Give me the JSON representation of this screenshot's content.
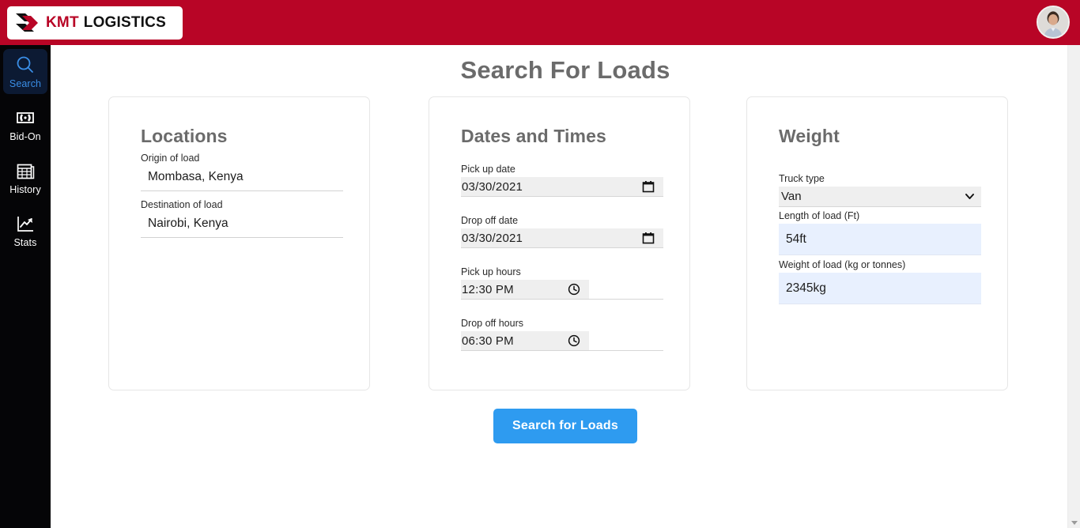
{
  "header": {
    "logo_icon": "double-chevron-arrow-icon",
    "logo_primary": "KMT",
    "logo_secondary": "LOGISTICS",
    "brand_red": "#b80526",
    "avatar_icon": "user-avatar-photo"
  },
  "sidebar": {
    "background": "#050507",
    "active_color": "#3a8ee6",
    "items": [
      {
        "label": "Search",
        "icon": "search-magnifier-icon",
        "active": true
      },
      {
        "label": "Bid-On",
        "icon": "banknote-money-icon",
        "active": false
      },
      {
        "label": "History",
        "icon": "newspaper-table-icon",
        "active": false
      },
      {
        "label": "Stats",
        "icon": "line-chart-up-icon",
        "active": false
      }
    ]
  },
  "main": {
    "page_title": "Search For Loads",
    "cards": {
      "locations": {
        "title": "Locations",
        "origin_label": "Origin of load",
        "origin_value": "Mombasa, Kenya",
        "destination_label": "Destination of load",
        "destination_value": "Nairobi, Kenya"
      },
      "dates": {
        "title": "Dates and Times",
        "pickup_date_label": "Pick up date",
        "pickup_date_value": "03/30/2021",
        "dropoff_date_label": "Drop off date",
        "dropoff_date_value": "03/30/2021",
        "pickup_hours_label": "Pick up hours",
        "pickup_hours_value": "12:30 PM",
        "dropoff_hours_label": "Drop off hours",
        "dropoff_hours_value": "06:30 PM",
        "date_icon": "calendar-picker-icon",
        "time_icon": "clock-picker-icon"
      },
      "weight": {
        "title": "Weight",
        "truck_type_label": "Truck type",
        "truck_type_value": "Van",
        "truck_type_icon": "chevron-down-icon",
        "length_label": "Length of load (Ft)",
        "length_value": "54ft",
        "weight_label": "Weight of load (kg or tonnes)",
        "weight_value": "2345kg"
      }
    },
    "submit_label": "Search for Loads",
    "submit_color": "#2e9bf0"
  },
  "scrollbar": {
    "down_arrow_icon": "scroll-down-arrow-icon"
  }
}
